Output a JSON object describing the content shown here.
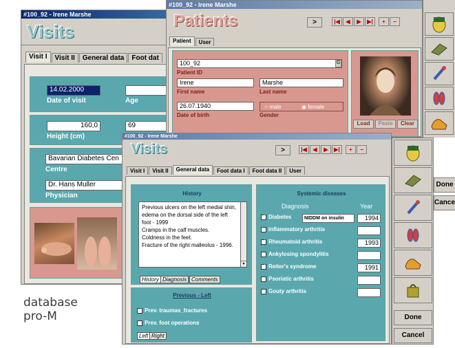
{
  "visits_back": {
    "window_title": "#100_92 - Irene Marshe",
    "heading": "Visits",
    "tabs": [
      "Visit I",
      "Visit II",
      "General data",
      "Foot dat"
    ],
    "date_of_visit_value": "14.02.2000",
    "date_of_visit_label": "Date of visit",
    "age_label": "Age",
    "height_value": "160,0",
    "height_label": "Height (cm)",
    "weight_value": "69",
    "centre_value": "Bavarian Diabetes Cen",
    "centre_label": "Centre",
    "physician_value": "Dr. Hans Muller",
    "physician_label": "Physician"
  },
  "patients": {
    "window_title": "#100_92 - Irene Marshe",
    "heading": "Patients",
    "tabs": [
      "Patient",
      "User"
    ],
    "patient_id_value": "100_92",
    "patient_id_label": "Patient ID",
    "first_name_value": "Irene",
    "first_name_label": "First name",
    "last_name_value": "Marshe",
    "last_name_label": "Last name",
    "dob_value": "26.07.1940",
    "dob_label": "Date of birth",
    "gender_label": "Gender",
    "gender_options": [
      "male",
      "female"
    ],
    "gender_selected": "female",
    "photo_buttons": [
      "Load",
      "Paste",
      "Clear"
    ]
  },
  "visits_front": {
    "window_title": "#100_92 - Irene Marshe",
    "heading": "Visits",
    "tabs": [
      "Visit I",
      "Visit II",
      "General data",
      "Foot data I",
      "Foot data II",
      "User"
    ],
    "history_title": "History",
    "history_text": "Previous ulcers on the left medial shin, edema on the dorsal side of the left foot - 1999\nCramps in the calf muscles.\nColdness in the feet.\nFracture of the right malleolus - 1996.",
    "history_subtabs": [
      "History",
      "Diagnosis",
      "Comments"
    ],
    "previous_title": "Previous - Left",
    "previous_items": [
      {
        "label": "Prev. traumas_fractures",
        "checked": true
      },
      {
        "label": "Prev. foot operations",
        "checked": false
      }
    ],
    "previous_subtabs": [
      "Left",
      "Right"
    ],
    "systemic_title": "Systemic diseases",
    "diagnosis_header": "Diagnosis",
    "year_header": "Year",
    "diseases": [
      {
        "label": "Diabetes",
        "checked": true,
        "extra": "NIDDM on insulin",
        "year": "1994"
      },
      {
        "label": "Inflammatory arthritis",
        "checked": false,
        "extra": "",
        "year": ""
      },
      {
        "label": "Rheumatoid arthritis",
        "checked": true,
        "extra": "",
        "year": "1993"
      },
      {
        "label": "Ankylosing spondylitis",
        "checked": false,
        "extra": "",
        "year": ""
      },
      {
        "label": "Reiter's syndrome",
        "checked": true,
        "extra": "",
        "year": "1991"
      },
      {
        "label": "Psoriatic arthritis",
        "checked": false,
        "extra": "",
        "year": ""
      },
      {
        "label": "Gouty arthritis",
        "checked": false,
        "extra": "",
        "year": ""
      }
    ]
  },
  "side_buttons": {
    "done_label": "Done",
    "cancel_label": "Cancel",
    "icons": [
      "head-icon",
      "hands-icon",
      "tool-icon",
      "feet-icon",
      "shoe-icon",
      "bag-icon"
    ]
  },
  "brand_line1": "database",
  "brand_line2": "pro-M"
}
